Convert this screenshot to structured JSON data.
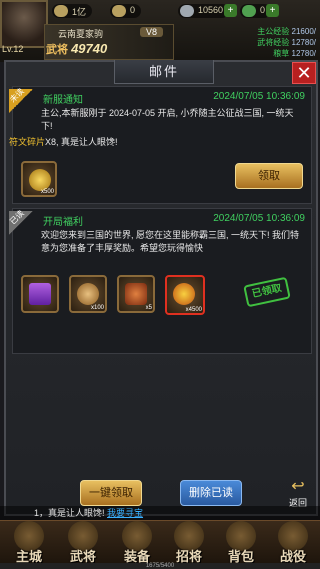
{
  "header": {
    "level": "Lv.12",
    "resources": [
      {
        "icon": "coin-icon",
        "value": "1亿"
      },
      {
        "icon": "gold-ingot-icon",
        "value": "0"
      },
      {
        "icon": "silver-ingot-icon",
        "value": "10560"
      },
      {
        "icon": "jade-icon",
        "value": "0"
      }
    ],
    "nickname": "云南夏家驹",
    "vip": "V8",
    "power_label": "武将",
    "power_value": "49740",
    "stats": [
      {
        "label": "主公经验",
        "value": "21600/"
      },
      {
        "label": "武将经验",
        "value": "12780/"
      },
      {
        "label": "粮草",
        "value": "12780/"
      }
    ]
  },
  "panel": {
    "title": "邮件",
    "close": "✕"
  },
  "mails": [
    {
      "status": "未读",
      "title": "新服通知",
      "time": "2024/07/05 10:36:09",
      "body": "主公,本新服刚于 2024-07-05 开启, 小乔随主公征战三国, 一统天下!",
      "attachment_line_prefix": "符文碎片",
      "attachment_line_count": "X8",
      "attachment_line_text": ", 真是让人眼馋!",
      "items": [
        {
          "icon": "gold-ingot-icon",
          "count": "x500"
        }
      ],
      "button": "领取"
    },
    {
      "status": "已读",
      "title": "开局福利",
      "time": "2024/07/05 10:36:09",
      "body": "欢迎您来到三国的世界, 愿您在这里能称霸三国, 一统天下! 我们特意为您准备了丰厚奖励。希望您玩得愉快",
      "items": [
        {
          "icon": "gift-box-icon",
          "count": ""
        },
        {
          "icon": "scroll-icon",
          "count": "x100"
        },
        {
          "icon": "treasure-chest-icon",
          "count": "x5"
        },
        {
          "icon": "vip-coin-icon",
          "count": "x4500"
        }
      ],
      "claimed": "已领取"
    }
  ],
  "actions": {
    "claim_all": "一键领取",
    "delete_read": "删除已读",
    "back": "返回"
  },
  "chat": {
    "text": "1，真是让人眼馋!",
    "link": "我要寻宝"
  },
  "exp": "1675/5400",
  "nav": [
    "主城",
    "武将",
    "装备",
    "招将",
    "背包",
    "战役"
  ]
}
